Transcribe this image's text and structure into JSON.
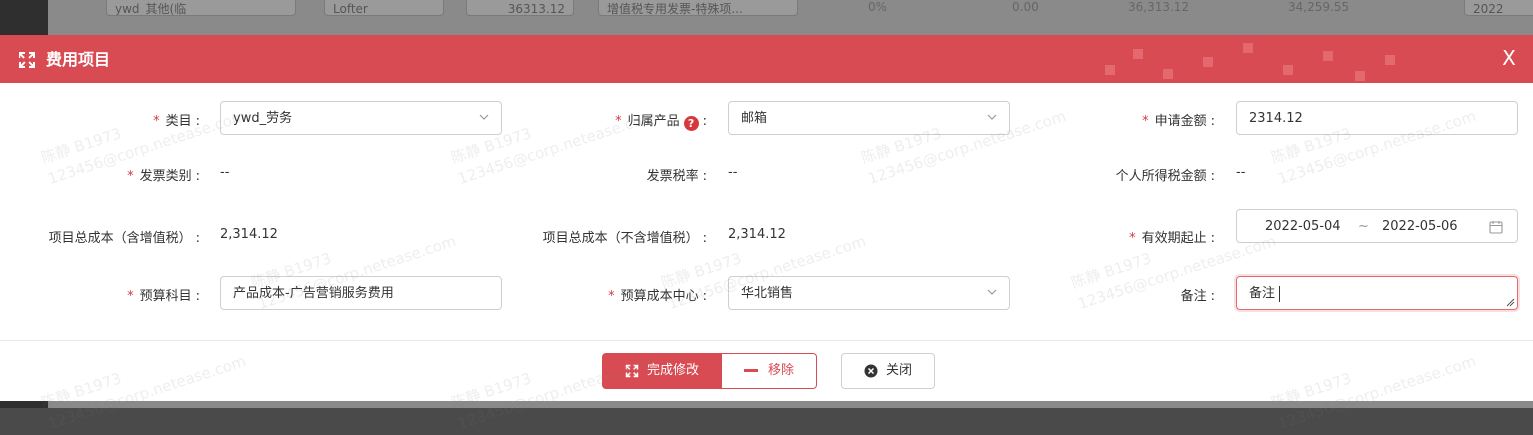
{
  "background": {
    "row_fields": [
      "ywd_其他(临",
      "Lofter",
      "36313.12",
      "增值税专用发票-特殊项..."
    ],
    "row_texts": [
      "0%",
      "0.00",
      "36,313.12",
      "34,259.55",
      "2022"
    ]
  },
  "modal": {
    "title": "费用项目",
    "close_glyph": "X",
    "accent_color": "#d94b52",
    "fields": {
      "category": {
        "label": "类目",
        "value": "ywd_劳务"
      },
      "product": {
        "label": "归属产品",
        "value": "邮箱",
        "help": "?"
      },
      "amount": {
        "label": "申请金额",
        "value": "2314.12"
      },
      "invoice_type": {
        "label": "发票类别",
        "value": "--"
      },
      "tax_rate": {
        "label": "发票税率",
        "value": "--"
      },
      "income_tax": {
        "label": "个人所得税金额",
        "value": "--"
      },
      "total_with_tax": {
        "label": "项目总成本（含增值税）",
        "value": "2,314.12"
      },
      "total_without_tax": {
        "label": "项目总成本（不含增值税）",
        "value": "2,314.12"
      },
      "validity": {
        "label": "有效期起止",
        "start": "2022-05-04",
        "sep": "~",
        "end": "2022-05-06"
      },
      "budget_subject": {
        "label": "预算科目",
        "value": "产品成本-广告营销服务费用"
      },
      "budget_center": {
        "label": "预算成本中心",
        "value": "华北销售"
      },
      "remark": {
        "label": "备注",
        "value": "备注"
      }
    },
    "buttons": {
      "done": "完成修改",
      "remove": "移除",
      "close": "关闭"
    }
  },
  "watermark": {
    "line1": "陈静 B1973",
    "line2": "123456@corp.netease.com"
  }
}
